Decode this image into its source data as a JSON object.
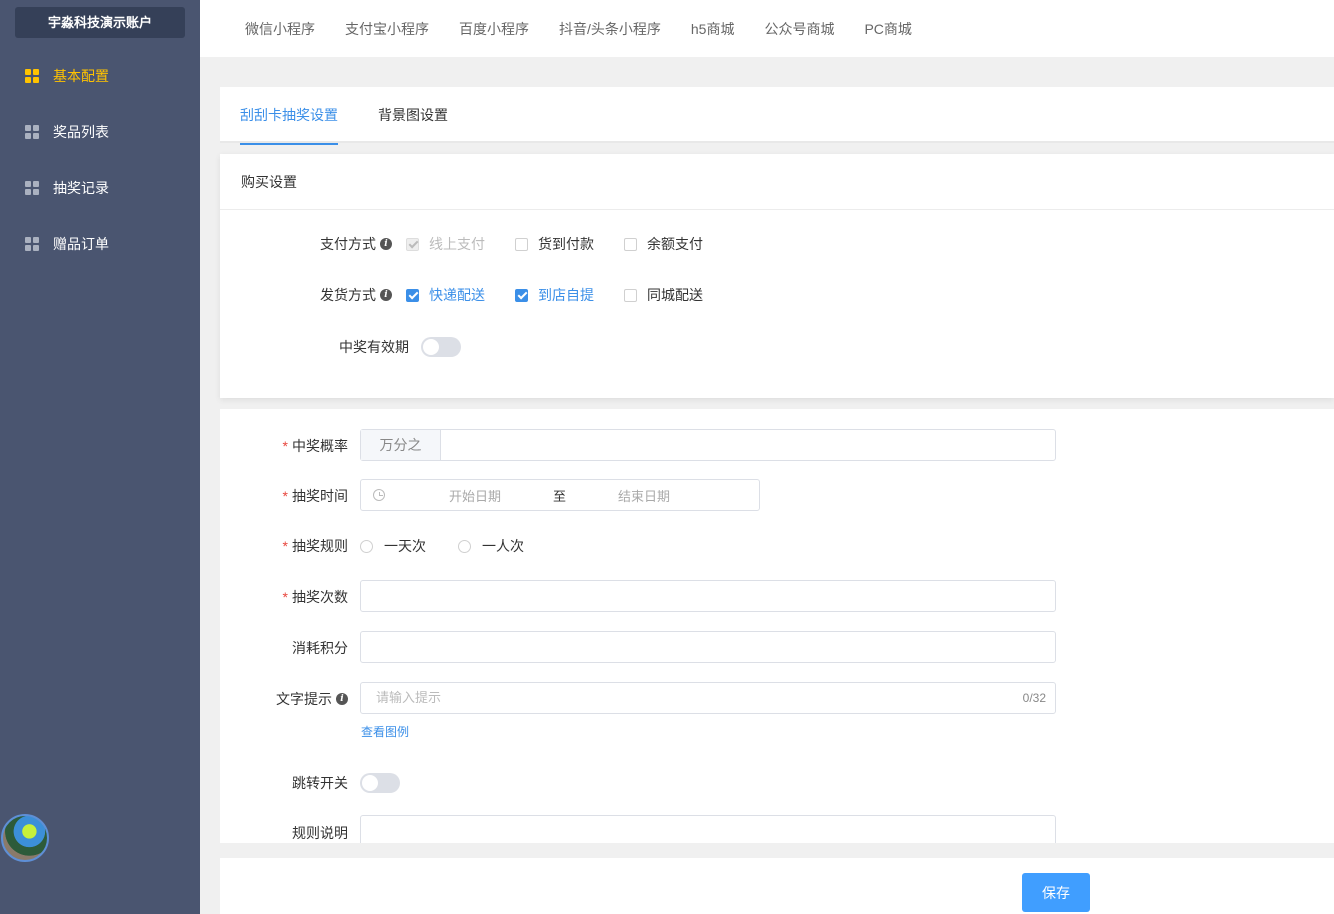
{
  "sidebar": {
    "account": "宇淼科技演示账户",
    "items": [
      {
        "label": "基本配置",
        "active": true
      },
      {
        "label": "奖品列表",
        "active": false
      },
      {
        "label": "抽奖记录",
        "active": false
      },
      {
        "label": "赠品订单",
        "active": false
      }
    ]
  },
  "topnav": [
    "微信小程序",
    "支付宝小程序",
    "百度小程序",
    "抖音/头条小程序",
    "h5商城",
    "公众号商城",
    "PC商城"
  ],
  "tabs": [
    "刮刮卡抽奖设置",
    "背景图设置"
  ],
  "purchase": {
    "title": "购买设置",
    "payment_label": "支付方式",
    "payment_options": [
      "线上支付",
      "货到付款",
      "余额支付"
    ],
    "delivery_label": "发货方式",
    "delivery_options": [
      "快递配送",
      "到店自提",
      "同城配送"
    ],
    "validity_label": "中奖有效期"
  },
  "form": {
    "probability_label": "中奖概率",
    "probability_prefix": "万分之",
    "time_label": "抽奖时间",
    "start_placeholder": "开始日期",
    "range_sep": "至",
    "end_placeholder": "结束日期",
    "rule_label": "抽奖规则",
    "rule_options": [
      "一天次",
      "一人次"
    ],
    "count_label": "抽奖次数",
    "points_label": "消耗积分",
    "tip_label": "文字提示",
    "tip_placeholder": "请输入提示",
    "tip_counter": "0/32",
    "example_link": "查看图例",
    "jump_label": "跳转开关",
    "rules_desc_label": "规则说明"
  },
  "footer": {
    "save_label": "保存"
  },
  "colors": {
    "sidebar": "#4a5570",
    "accent": "#3b8fe8",
    "active_menu": "#ffc300",
    "primary_button": "#409eff"
  }
}
